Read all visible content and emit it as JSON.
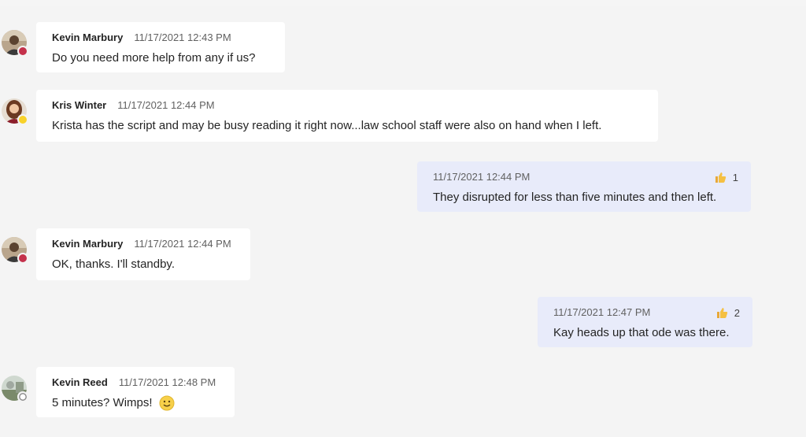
{
  "colors": {
    "presence_busy": "#c4314b",
    "presence_away": "#f8d22a",
    "presence_offline": "#8a8a8a",
    "my_bubble": "#e8ebfa",
    "other_bubble": "#ffffff"
  },
  "messages": [
    {
      "author": "Kevin Marbury",
      "timestamp": "11/17/2021 12:43 PM",
      "text": "Do you need more help from any if us?",
      "presence": "busy"
    },
    {
      "author": "Kris Winter",
      "timestamp": "11/17/2021 12:44 PM",
      "text": "Krista has the script and may be busy reading it right now...law school staff were also on hand when I left.",
      "presence": "away"
    },
    {
      "author": "",
      "timestamp": "11/17/2021 12:44 PM",
      "text": "They disrupted for less than five minutes and then left.",
      "mine": true,
      "reaction_icon": "thumbs-up-icon",
      "reaction_count": "1"
    },
    {
      "author": "Kevin Marbury",
      "timestamp": "11/17/2021 12:44 PM",
      "text": "OK, thanks. I'll standby.",
      "presence": "busy"
    },
    {
      "author": "",
      "timestamp": "11/17/2021 12:47 PM",
      "text": "Kay heads up that ode was there.",
      "mine": true,
      "reaction_icon": "thumbs-up-icon",
      "reaction_count": "2"
    },
    {
      "author": "Kevin Reed",
      "timestamp": "11/17/2021 12:48 PM",
      "text": "5 minutes? Wimps!",
      "presence": "offline",
      "trailing_emoji": "smile-emoji-icon"
    }
  ]
}
